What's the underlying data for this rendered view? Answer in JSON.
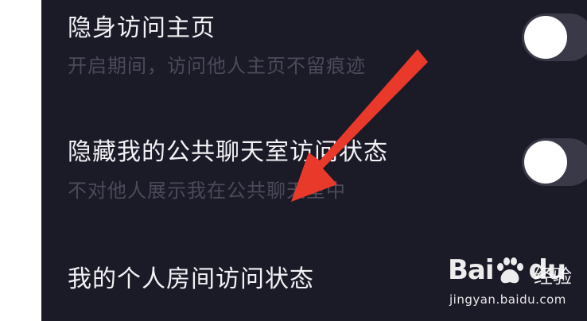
{
  "settings": [
    {
      "title": "隐身访问主页",
      "subtitle": "开启期间，访问他人主页不留痕迹",
      "toggle_on": false
    },
    {
      "title": "隐藏我的公共聊天室访问状态",
      "subtitle": "不对他人展示我在公共聊天室中",
      "toggle_on": false
    },
    {
      "title": "我的个人房间访问状态"
    }
  ],
  "annotation": {
    "arrow_color": "#e8392b"
  },
  "watermark": {
    "brand": "Bai",
    "brand_suffix": "du",
    "label": "经验",
    "url": "jingyan.baidu.com"
  },
  "colors": {
    "panel_bg": "#1b1a27",
    "title_text": "#f2f2f5",
    "subtitle_text": "#4b4a5a",
    "toggle_track": "#3a3948",
    "toggle_knob": "#ffffff"
  }
}
